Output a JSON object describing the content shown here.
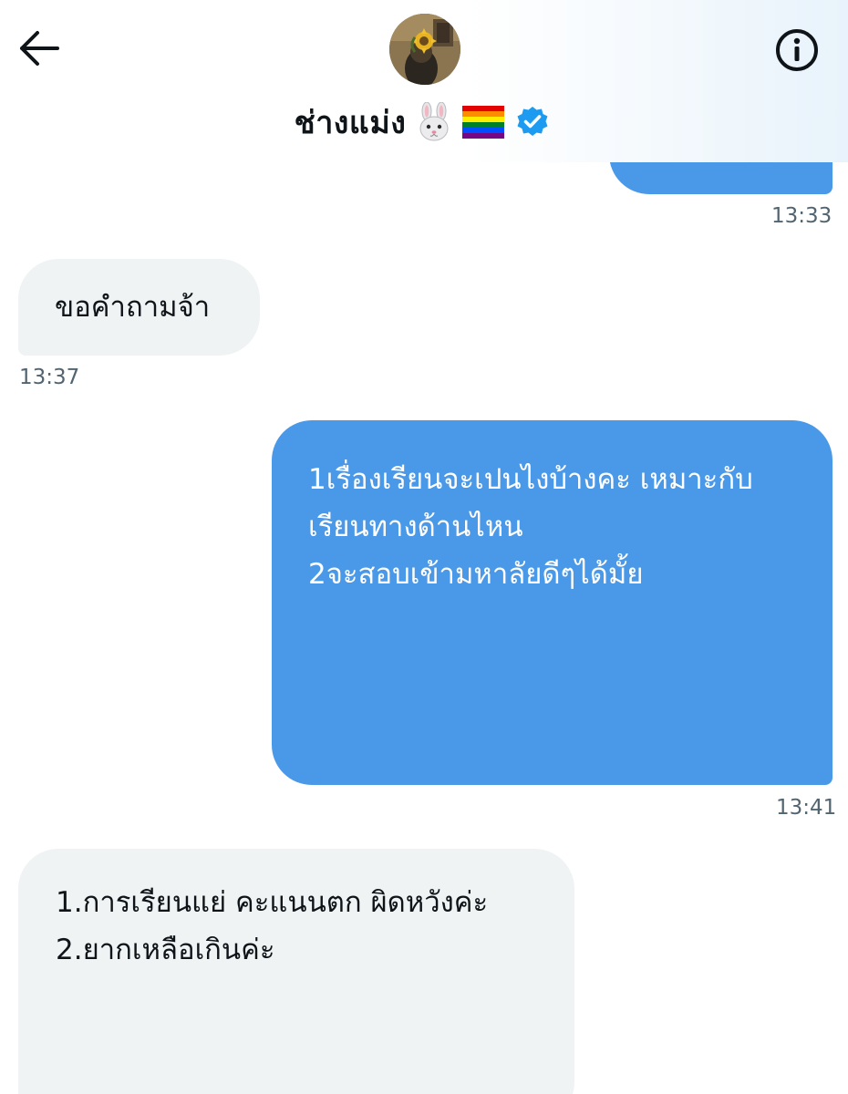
{
  "header": {
    "display_name": "ช่างแม่ง",
    "emojis": [
      "rabbit-face",
      "rainbow-flag"
    ],
    "verified": true,
    "back_icon": "arrow-left-icon",
    "info_icon": "info-icon"
  },
  "colors": {
    "sent_bubble": "#4a98e8",
    "received_bubble": "#eff3f4",
    "verified_badge": "#1d9bf0",
    "timestamp": "#536471"
  },
  "messages": [
    {
      "direction": "sent",
      "text": "",
      "time": "13:33"
    },
    {
      "direction": "received",
      "text": "ขอคำถามจ้า",
      "time": "13:37"
    },
    {
      "direction": "sent",
      "text": "1เรื่องเรียนจะเปนไงบ้างคะ เหมาะกับ\nเรียนทางด้านไหน\n2จะสอบเข้ามหาลัยดีๆได้มั้ย",
      "time": "13:41"
    },
    {
      "direction": "received",
      "text": "1.การเรียนแย่ คะแนนตก ผิดหวังค่ะ\n2.ยากเหลือเกินค่ะ",
      "time": ""
    }
  ]
}
